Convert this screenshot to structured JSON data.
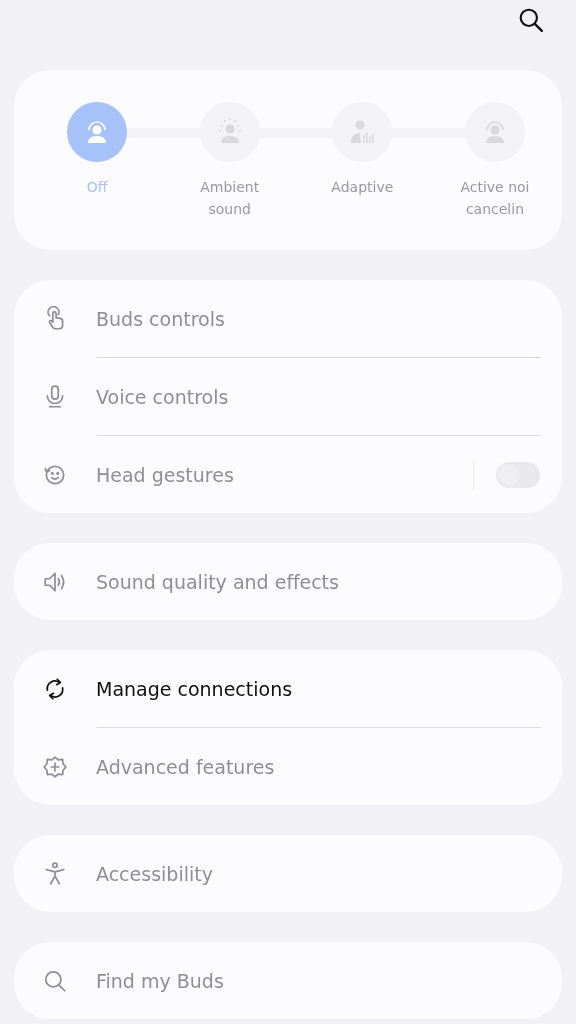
{
  "modes": [
    {
      "label": "Off",
      "selected": true
    },
    {
      "label": "Ambient sound",
      "selected": false
    },
    {
      "label": "Adaptive",
      "selected": false
    },
    {
      "label": "Active noi cancelin",
      "selected": false
    }
  ],
  "sections": [
    {
      "items": [
        {
          "label": "Buds controls",
          "disabled": true
        },
        {
          "label": "Voice controls",
          "disabled": true
        },
        {
          "label": "Head gestures",
          "disabled": true,
          "switch": {
            "on": false
          }
        }
      ]
    },
    {
      "items": [
        {
          "label": "Sound quality and effects",
          "disabled": true
        }
      ]
    },
    {
      "items": [
        {
          "label": "Manage connections",
          "disabled": false
        },
        {
          "label": "Advanced features",
          "disabled": true
        }
      ]
    },
    {
      "items": [
        {
          "label": "Accessibility",
          "disabled": true
        }
      ]
    },
    {
      "items": [
        {
          "label": "Find my Buds",
          "disabled": true
        }
      ]
    }
  ]
}
